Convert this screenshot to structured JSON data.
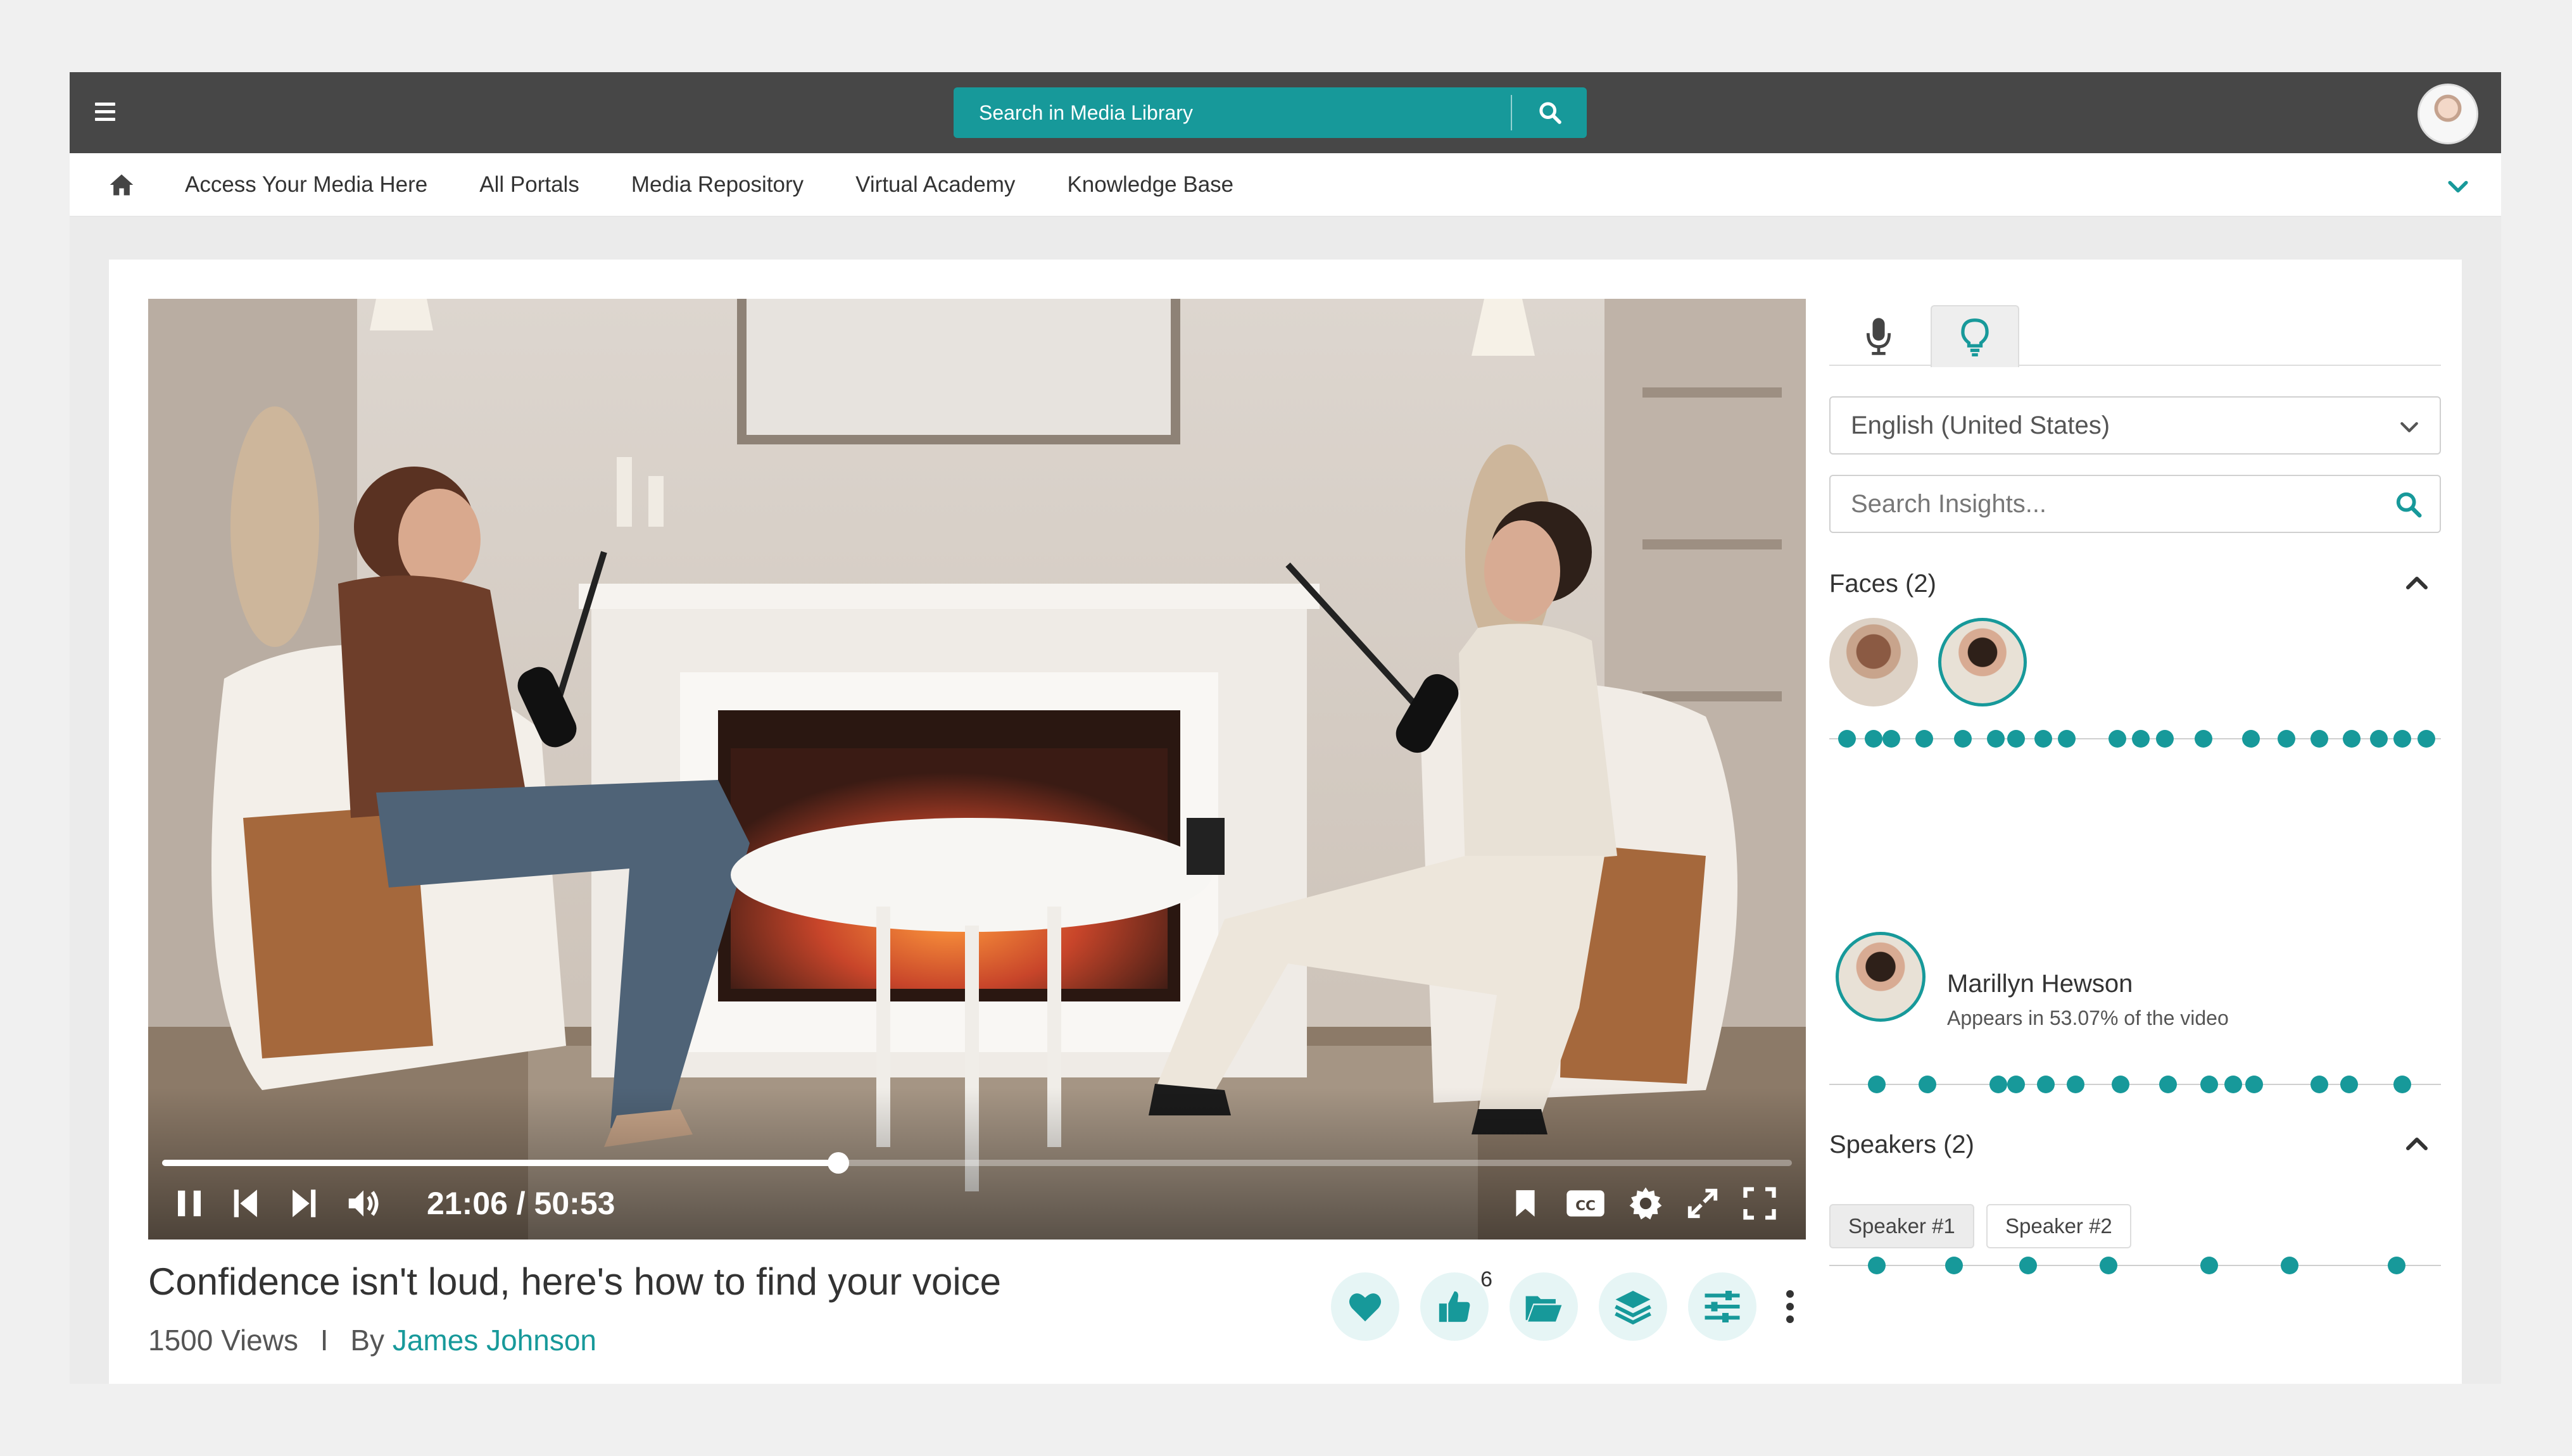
{
  "header": {
    "search_placeholder": "Search in Media Library"
  },
  "nav": {
    "items": [
      {
        "label": "Access Your Media Here"
      },
      {
        "label": "All Portals"
      },
      {
        "label": "Media Repository"
      },
      {
        "label": "Virtual Academy"
      },
      {
        "label": "Knowledge Base"
      }
    ]
  },
  "player": {
    "time": "21:06 / 50:53",
    "progress_fraction": 0.415
  },
  "video": {
    "title": "Confidence isn't loud, here's how to find your voice",
    "views": "1500 Views",
    "separator": "I",
    "by": "By",
    "author": "James Johnson",
    "like_count": "6"
  },
  "insights": {
    "language": "English (United States)",
    "search_placeholder": "Search Insights...",
    "faces_title": "Faces (2)",
    "faces_timeline_fractions": [
      0.015,
      0.06,
      0.09,
      0.145,
      0.21,
      0.265,
      0.3,
      0.345,
      0.385,
      0.47,
      0.51,
      0.55,
      0.615,
      0.695,
      0.755,
      0.81,
      0.865,
      0.91,
      0.95,
      0.99
    ],
    "person": {
      "name": "Marillyn Hewson",
      "appears": "Appears in 53.07% of the video",
      "timeline_fractions": [
        0.065,
        0.15,
        0.27,
        0.3,
        0.35,
        0.4,
        0.475,
        0.555,
        0.625,
        0.665,
        0.7,
        0.81,
        0.86,
        0.95
      ]
    },
    "speakers_title": "Speakers (2)",
    "speakers": [
      {
        "label": "Speaker #1"
      },
      {
        "label": "Speaker #2"
      }
    ],
    "speakers_timeline_fractions": [
      0.065,
      0.195,
      0.32,
      0.455,
      0.625,
      0.76,
      0.94
    ]
  },
  "colors": {
    "accent": "#17999a",
    "topbar": "#474747"
  }
}
